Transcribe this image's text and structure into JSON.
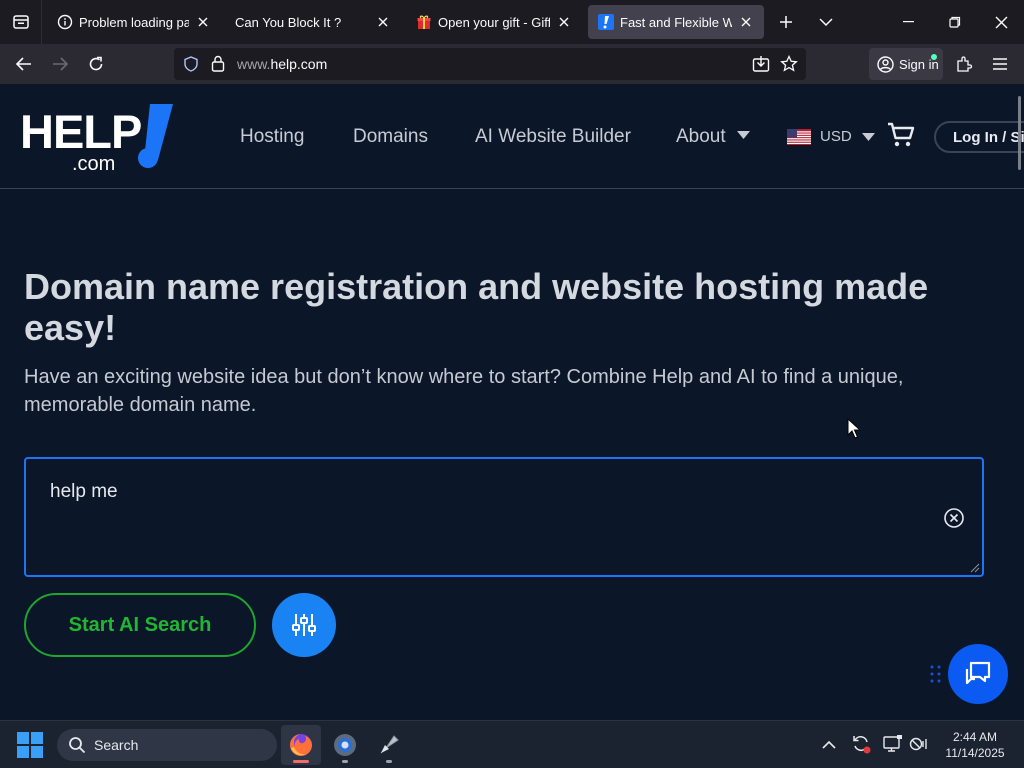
{
  "browser": {
    "tabs": [
      {
        "title": "Problem loading page",
        "active": false
      },
      {
        "title": "Can You Block It ?",
        "active": false
      },
      {
        "title": "Open your gift - Gifft.m",
        "active": false
      },
      {
        "title": "Fast and Flexible Web H",
        "active": true
      }
    ],
    "url": {
      "prefix": "www.",
      "domain": "help.com"
    },
    "sign_in_label": "Sign in",
    "accent": "#54ffbd"
  },
  "site": {
    "logo": {
      "word": "HELP",
      "suffix": ".com",
      "brand_color": "#1c74f6"
    },
    "nav": [
      "Hosting",
      "Domains",
      "AI Website Builder",
      "About"
    ],
    "currency": "USD",
    "login_label": "Log In / Sign Up"
  },
  "hero": {
    "title": "Domain name registration and website hosting made easy!",
    "subtitle": "Have an exciting website idea but don’t know where to start? Combine Help and AI to find a unique, memorable domain name.",
    "search_value": "help me",
    "start_button": "Start AI Search",
    "accent_green": "#22b533",
    "accent_blue": "#1a83f4"
  },
  "taskbar": {
    "search_label": "Search",
    "time": "2:44 AM",
    "date": "11/14/2025"
  }
}
